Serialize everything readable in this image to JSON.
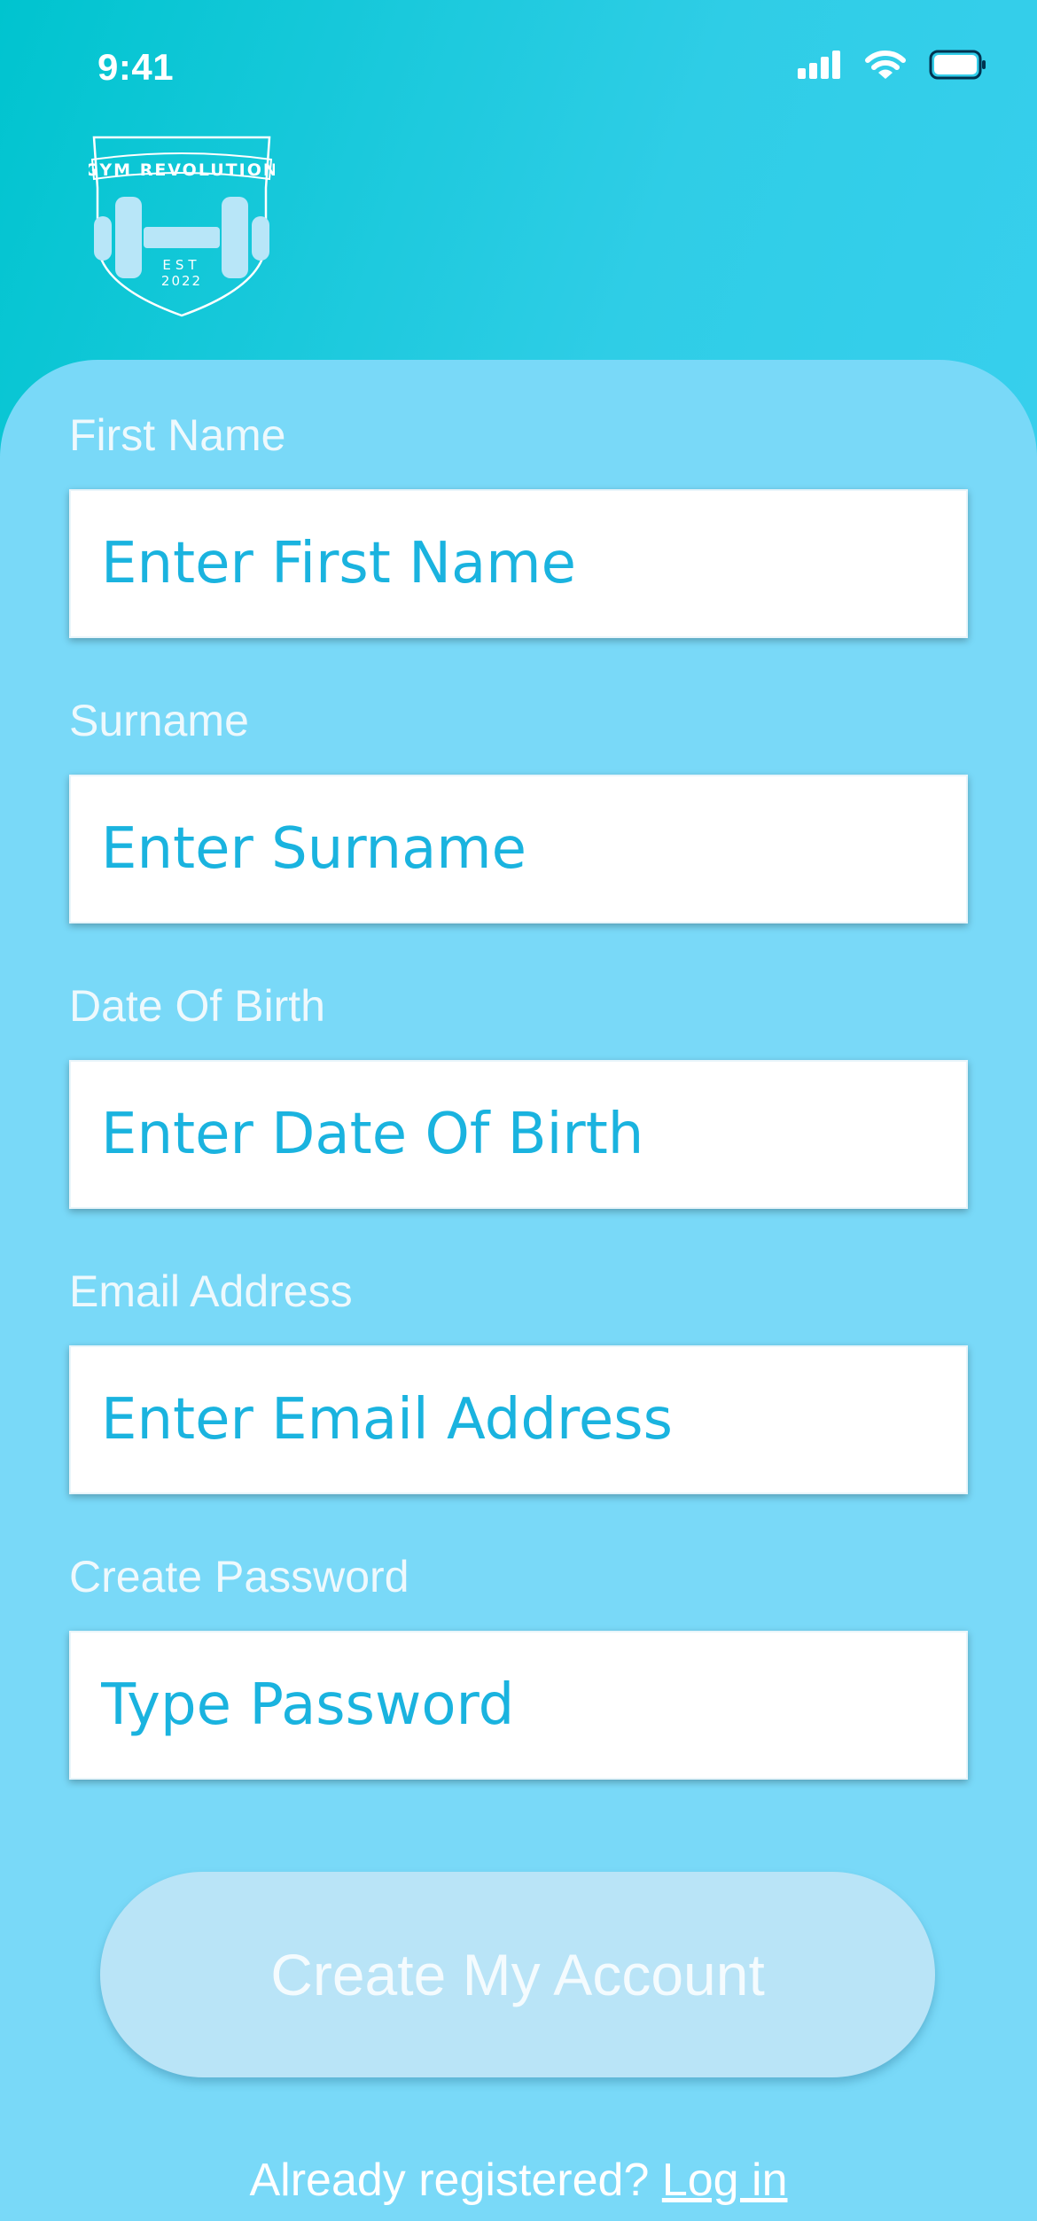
{
  "status_bar": {
    "time": "9:41",
    "icons": [
      "cellular-signal-icon",
      "wifi-icon",
      "battery-icon"
    ]
  },
  "logo": {
    "text": "GYM REVOLUTION",
    "est": "EST",
    "year": "2022",
    "icon": "dumbbell-icon"
  },
  "form": {
    "first_name": {
      "label": "First Name",
      "placeholder": "Enter First Name"
    },
    "surname": {
      "label": "Surname",
      "placeholder": "Enter Surname"
    },
    "date_of_birth": {
      "label": "Date Of Birth",
      "placeholder": "Enter Date Of Birth"
    },
    "email": {
      "label": "Email Address",
      "placeholder": "Enter Email Address"
    },
    "password": {
      "label": "Create Password",
      "placeholder": "Type Password"
    }
  },
  "actions": {
    "create_label": "Create My Account",
    "login_prompt": "Already registered? ",
    "login_link": "Log in"
  },
  "colors": {
    "background_start": "#00c4cf",
    "background_end": "#43d2f6",
    "card": "#79d9f8",
    "input_text": "#1ab3df",
    "button": "#b9e4f7"
  }
}
